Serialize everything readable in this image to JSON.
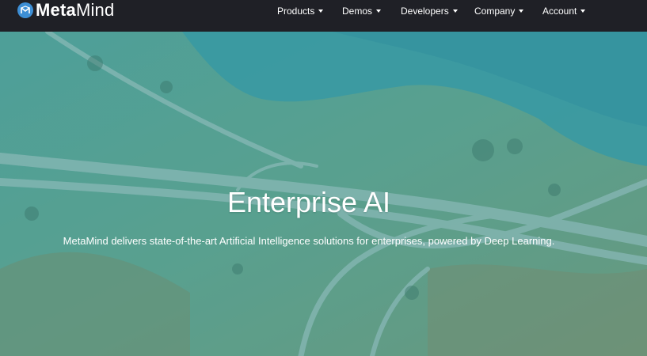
{
  "brand": {
    "name_bold": "Meta",
    "name_light": "Mind",
    "logo_icon": "metamind-logo-icon"
  },
  "nav": {
    "items": [
      {
        "label": "Products",
        "icon": "caret-down-icon"
      },
      {
        "label": "Demos",
        "icon": "caret-down-icon"
      },
      {
        "label": "Developers",
        "icon": "caret-down-icon"
      },
      {
        "label": "Company",
        "icon": "caret-down-icon"
      },
      {
        "label": "Account",
        "icon": "caret-down-icon"
      }
    ]
  },
  "hero": {
    "title": "Enterprise AI",
    "subtitle": "MetaMind delivers state-of-the-art Artificial Intelligence solutions for enterprises, powered by Deep Learning.",
    "background": "aerial-highway-interchange-photo"
  },
  "colors": {
    "navbar": "#1f2026",
    "logo_blue": "#3d8fd6",
    "hero_tint": "#3a9a9c"
  }
}
